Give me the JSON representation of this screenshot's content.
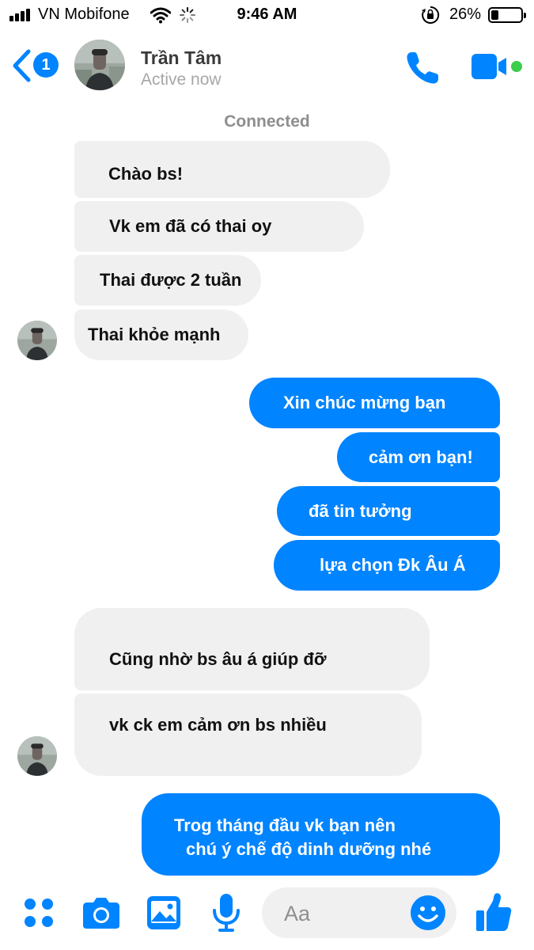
{
  "status_bar": {
    "carrier": "VN Mobifone",
    "time": "9:46 AM",
    "battery_percent": "26%",
    "battery_level": 0.26,
    "icons": [
      "signal-icon",
      "wifi-icon",
      "loading-spinner-icon",
      "orientation-lock-icon",
      "battery-icon"
    ]
  },
  "header": {
    "unread_count": "1",
    "contact_name": "Trần Tâm",
    "contact_status": "Active now",
    "icons": [
      "back-chevron-icon",
      "phone-icon",
      "video-camera-icon"
    ],
    "online_color": "#3ccd4b"
  },
  "conversation": {
    "connected_label": "Connected",
    "messages": [
      {
        "from": "contact",
        "text": "Chào bs!"
      },
      {
        "from": "contact",
        "text": "Vk em đã có thai oy"
      },
      {
        "from": "contact",
        "text": "Thai được 2 tuần"
      },
      {
        "from": "contact",
        "text": "Thai khỏe mạnh"
      },
      {
        "from": "me",
        "text": "Xin chúc mừng bạn"
      },
      {
        "from": "me",
        "text": "cảm ơn bạn!"
      },
      {
        "from": "me",
        "text": "đã tin tưởng"
      },
      {
        "from": "me",
        "text": "lựa chọn Đk Âu Á"
      },
      {
        "from": "contact",
        "text": "Cũng nhờ bs âu á giúp đỡ"
      },
      {
        "from": "contact",
        "text": "vk ck em cảm ơn bs nhiều"
      },
      {
        "from": "me",
        "lines": [
          "Trog  tháng đầu vk bạn nên",
          "chú ý chế độ dinh dưỡng nhé"
        ]
      }
    ]
  },
  "composer": {
    "placeholder": "Aa",
    "icons": [
      "apps-grid-icon",
      "camera-icon",
      "photo-icon",
      "microphone-icon",
      "emoji-icon",
      "thumbs-up-icon"
    ]
  },
  "colors": {
    "accent": "#0084ff",
    "incoming_bubble": "#f0f0f0",
    "muted_text": "#a7a7a7"
  }
}
